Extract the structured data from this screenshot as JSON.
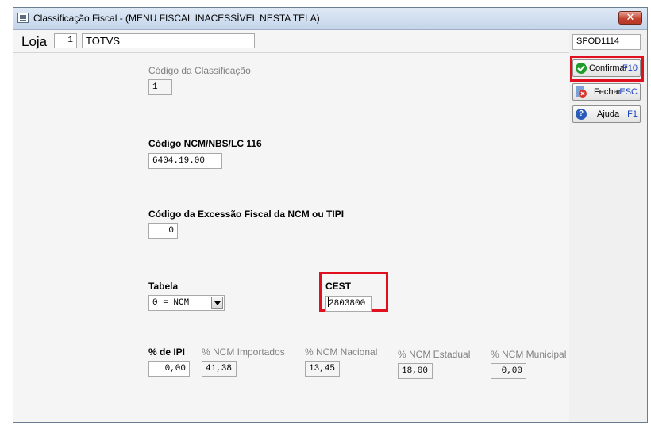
{
  "window": {
    "title": "Classificação Fiscal - (MENU FISCAL INACESSÍVEL NESTA TELA)",
    "close_label": "✕"
  },
  "loja": {
    "label": "Loja",
    "code": "1",
    "name": "TOTVS"
  },
  "screen_code": "SPOD1114",
  "fields": {
    "codigo_classificacao": {
      "label": "Código da Classificação",
      "value": "1"
    },
    "codigo_ncm": {
      "label": "Código NCM/NBS/LC 116",
      "value": "6404.19.00"
    },
    "excecao_fiscal": {
      "label": "Código da Excessão Fiscal da NCM ou TIPI",
      "value": "0"
    },
    "tabela": {
      "label": "Tabela",
      "value": "0 = NCM"
    },
    "cest": {
      "label": "CEST",
      "value": "2803800"
    },
    "ipi": {
      "label": "% de IPI",
      "value": "0,00"
    },
    "ncm_importados": {
      "label": "% NCM Importados",
      "value": "41,38"
    },
    "ncm_nacional": {
      "label": "% NCM Nacional",
      "value": "13,45"
    },
    "ncm_estadual": {
      "label": "% NCM Estadual",
      "value": "18,00"
    },
    "ncm_municipal": {
      "label": "% NCM Municipal",
      "value": "0,00"
    }
  },
  "buttons": {
    "confirmar": {
      "label": "Confirmar",
      "key": "F10",
      "icon": "check-icon"
    },
    "fechar": {
      "label": "Fechar",
      "key": "ESC",
      "icon": "close-doc-icon"
    },
    "ajuda": {
      "label": "Ajuda",
      "key": "F1",
      "icon": "help-icon"
    }
  },
  "colors": {
    "highlight": "#e01020",
    "key_text": "#1a3fbf"
  }
}
